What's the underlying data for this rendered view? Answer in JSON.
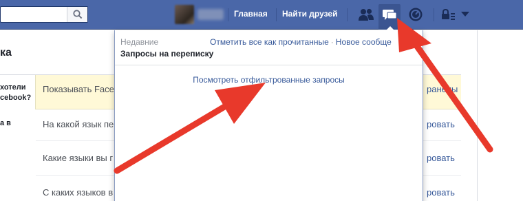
{
  "topbar": {
    "nav": [
      {
        "label": "Главная"
      },
      {
        "label": "Найти друзей"
      }
    ],
    "icons": {
      "search": "search-icon",
      "friend_requests": "friend-requests-icon",
      "messages": "messages-icon",
      "notifications": "notifications-icon",
      "privacy": "privacy-lock-icon",
      "account_menu": "chevron-down-icon"
    }
  },
  "page": {
    "section_title": "ка",
    "rows": [
      {
        "question": [
          "хотели",
          "cebook?"
        ],
        "text": "Показывать Face",
        "link": "ранены"
      },
      {
        "question": [
          "а в",
          ""
        ],
        "text": "На какой язык пе",
        "link": "ровать"
      },
      {
        "question": [
          "",
          ""
        ],
        "text": "Какие языки вы г",
        "link": "ровать"
      },
      {
        "question": [
          "",
          ""
        ],
        "text": "С каких языков в",
        "link": "ровать"
      }
    ]
  },
  "dropdown": {
    "recent_label": "Недавние",
    "mark_all_read": "Отметить все как прочитанные",
    "separator": "·",
    "new_message": "Новое сообще",
    "title": "Запросы на переписку",
    "filtered_requests_link": "Посмотреть отфильтрованные запросы"
  },
  "colors": {
    "topbar": "#4a67a8",
    "link": "#365899",
    "highlight_row": "#fff9d7",
    "arrow": "#e8392b"
  }
}
